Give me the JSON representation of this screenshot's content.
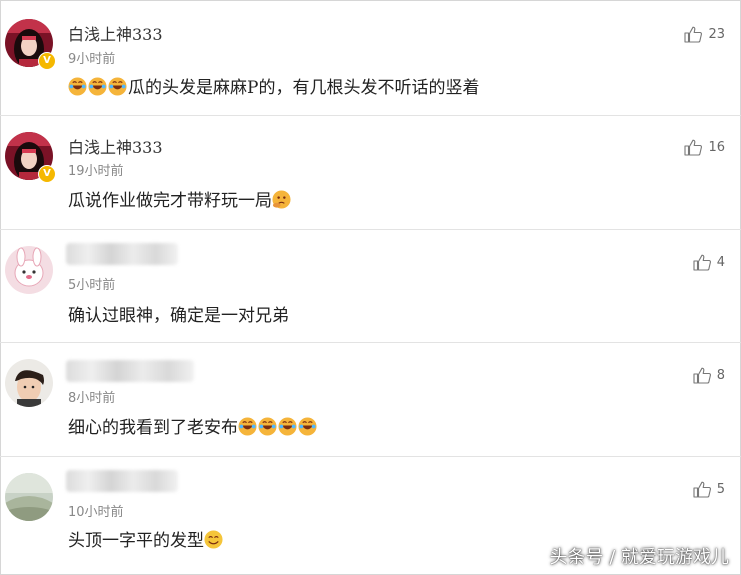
{
  "comments": [
    {
      "username": "白浅上神333",
      "time": "9小时前",
      "text": "瓜的头发是麻麻P的，有几根头发不听话的竖着",
      "emoji_before": [
        "laugh-cry-emoji",
        "laugh-cry-emoji",
        "laugh-cry-emoji"
      ],
      "emoji_after": [],
      "likes": "23",
      "verified": true,
      "name_visible": true
    },
    {
      "username": "白浅上神333",
      "time": "19小时前",
      "text": "瓜说作业做完才带籽玩一局",
      "emoji_before": [],
      "emoji_after": [
        "thinking-emoji"
      ],
      "likes": "16",
      "verified": true,
      "name_visible": true
    },
    {
      "username": "",
      "time": "5小时前",
      "text": "确认过眼神，确定是一对兄弟",
      "emoji_before": [],
      "emoji_after": [],
      "likes": "4",
      "verified": false,
      "name_visible": false
    },
    {
      "username": "",
      "time": "8小时前",
      "text": "细心的我看到了老安布",
      "emoji_before": [],
      "emoji_after": [
        "laugh-cry-emoji",
        "laugh-cry-emoji",
        "laugh-cry-emoji",
        "laugh-cry-emoji"
      ],
      "likes": "8",
      "verified": false,
      "name_visible": false
    },
    {
      "username": "",
      "time": "10小时前",
      "text": "头顶一字平的发型",
      "emoji_before": [],
      "emoji_after": [
        "smile-emoji"
      ],
      "likes": "5",
      "verified": false,
      "name_visible": false
    }
  ],
  "watermark": "头条号 / 就爱玩游戏儿",
  "icons": {
    "like": "thumbs-up-icon",
    "verified": "verified-v-badge"
  },
  "colors": {
    "username": "#333333",
    "time": "#888888",
    "text": "#222222",
    "divider": "#e3e3e3",
    "badge": "#f5b800",
    "like": "#666666"
  }
}
